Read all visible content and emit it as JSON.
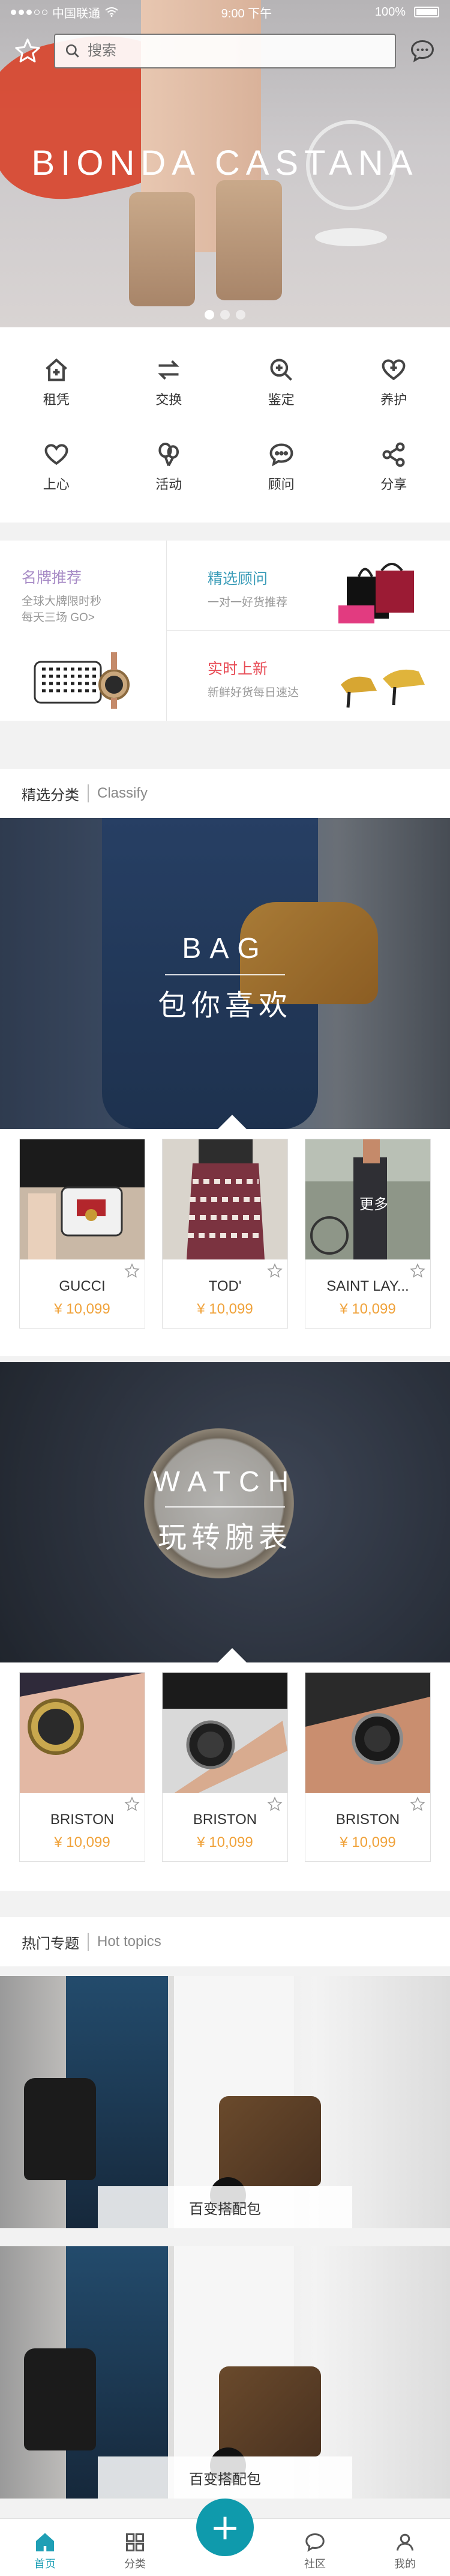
{
  "status_bar": {
    "carrier": "中国联通",
    "wifi_icon": "wifi-icon",
    "time": "9:00 下午",
    "battery": "100%"
  },
  "header": {
    "favorite_icon": "star-icon",
    "search_placeholder": "搜索",
    "message_icon": "chat-bubble-icon"
  },
  "hero": {
    "brand": "BIONDA CASTANA",
    "slides_total": 3,
    "active_slide": 1
  },
  "services": [
    {
      "label": "租凭",
      "icon": "home-icon"
    },
    {
      "label": "交换",
      "icon": "swap-arrows-icon"
    },
    {
      "label": "鉴定",
      "icon": "magnifier-plus-icon"
    },
    {
      "label": "养护",
      "icon": "heart-plus-icon"
    },
    {
      "label": "上心",
      "icon": "heart-icon"
    },
    {
      "label": "活动",
      "icon": "balloon-icon"
    },
    {
      "label": "顾问",
      "icon": "chat-dots-icon"
    },
    {
      "label": "分享",
      "icon": "share-icon"
    }
  ],
  "promo": {
    "left": {
      "title": "名牌推荐",
      "line1": "全球大牌限时秒",
      "line2": "每天三场 GO>"
    },
    "right_top": {
      "title": "精选顾问",
      "sub": "一对一好货推荐"
    },
    "right_bottom": {
      "title": "实时上新",
      "sub": "新鲜好货每日速达"
    }
  },
  "classify": {
    "title": "精选分类",
    "en": "Classify"
  },
  "bag_banner": {
    "en": "BAG",
    "zh": "包你喜欢"
  },
  "bag_cards": [
    {
      "name": "GUCCI",
      "price": "¥ 10,099",
      "more": ""
    },
    {
      "name": "TOD'",
      "price": "¥ 10,099",
      "more": ""
    },
    {
      "name": "SAINT LAY...",
      "price": "¥ 10,099",
      "more": "更多"
    }
  ],
  "watch_banner": {
    "en": "WATCH",
    "zh": "玩转腕表"
  },
  "watch_cards": [
    {
      "name": "BRISTON",
      "price": "¥ 10,099"
    },
    {
      "name": "BRISTON",
      "price": "¥ 10,099"
    },
    {
      "name": "BRISTON",
      "price": "¥ 10,099"
    }
  ],
  "hot": {
    "title": "热门专题",
    "en": "Hot topics"
  },
  "topics": [
    {
      "caption": "百变搭配包"
    },
    {
      "caption": "百变搭配包"
    }
  ],
  "tabbar": {
    "tabs": [
      {
        "label": "首页",
        "icon": "home-icon",
        "active": true
      },
      {
        "label": "分类",
        "icon": "grid-icon",
        "active": false
      },
      {
        "label": "",
        "icon": "plus-icon",
        "active": false
      },
      {
        "label": "社区",
        "icon": "community-chat-icon",
        "active": false
      },
      {
        "label": "我的",
        "icon": "user-icon",
        "active": false
      }
    ],
    "fab_symbol": "+"
  },
  "colors": {
    "accent": "#1f9fb5",
    "price": "#f0a23a",
    "fab": "#0f9aac"
  }
}
